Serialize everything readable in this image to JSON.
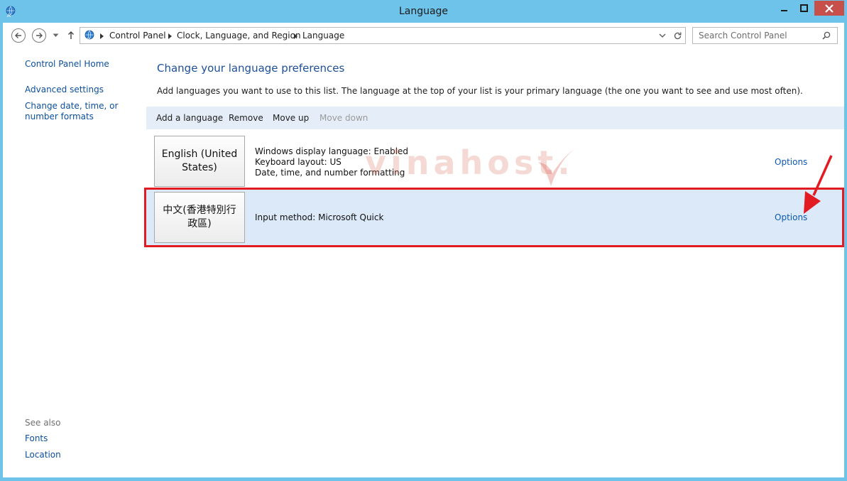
{
  "window": {
    "title": "Language",
    "icons": {
      "app": "language-globe-icon",
      "minimize": "minimize-icon",
      "maximize": "maximize-icon",
      "close": "close-icon"
    }
  },
  "navigation": {
    "breadcrumb": [
      "Control Panel",
      "Clock, Language, and Region",
      "Language"
    ],
    "search_placeholder": "Search Control Panel",
    "icons": {
      "back": "back-arrow-icon",
      "forward": "forward-arrow-icon",
      "recent": "chevron-down-icon",
      "up": "up-arrow-icon",
      "dropdown": "chevron-down-icon",
      "refresh": "refresh-icon",
      "search": "search-icon"
    }
  },
  "sidebar": {
    "links": [
      "Control Panel Home",
      "Advanced settings",
      "Change date, time, or number formats"
    ],
    "see_also_label": "See also",
    "see_also_links": [
      "Fonts",
      "Location"
    ]
  },
  "main": {
    "heading": "Change your language preferences",
    "description": "Add languages you want to use to this list. The language at the top of your list is your primary language (the one you want to see and use most often).",
    "toolbar": [
      "Add a language",
      "Remove",
      "Move up",
      "Move down"
    ],
    "languages": [
      {
        "name": "English (United States)",
        "details": [
          "Windows display language: Enabled",
          "Keyboard layout: US",
          "Date, time, and number formatting"
        ],
        "options_label": "Options"
      },
      {
        "name": "中文(香港特別行政區)",
        "details": [
          "Input method: Microsoft Quick"
        ],
        "options_label": "Options"
      }
    ]
  },
  "overlay": {
    "watermark_text": "vinahost.",
    "highlight_color": "#e21b22",
    "arrow_color": "#e21b22"
  },
  "colors": {
    "titlebar": "#6ec3ea",
    "link": "#0b4f9c",
    "heading": "#1d4f9a",
    "toolbar_bg": "#e5eef8",
    "selected_row_bg": "#dbe9f9",
    "close_button": "#c7504a"
  }
}
